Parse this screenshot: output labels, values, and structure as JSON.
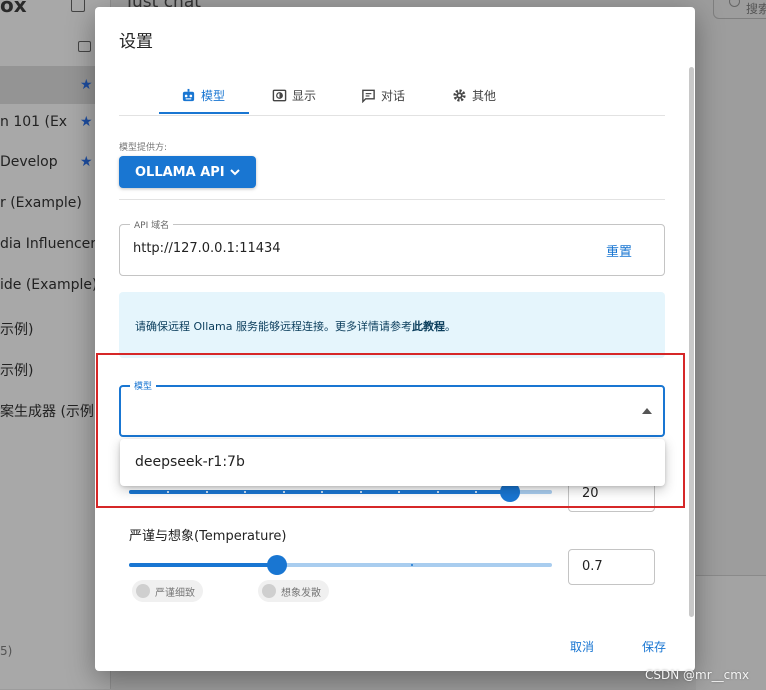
{
  "background": {
    "brand": "ox",
    "chat_title": "Just chat",
    "search_placeholder": "搜索",
    "sidebar_items": [
      {
        "label": "n 101 (Ex",
        "starred": true
      },
      {
        "label": "Develop",
        "starred": true
      },
      {
        "label": "r (Example)",
        "starred": false
      },
      {
        "label": "dia Influencer",
        "starred": false
      },
      {
        "label": "ide (Example)",
        "starred": false
      },
      {
        "label": "示例)",
        "starred": false
      },
      {
        "label": "示例)",
        "starred": false
      },
      {
        "label": "案生成器 (示例)",
        "starred": false
      }
    ],
    "corner_text": "5)"
  },
  "dialog": {
    "title": "设置",
    "tabs": [
      {
        "label": "模型",
        "icon": "robot-icon",
        "active": true
      },
      {
        "label": "显示",
        "icon": "display-icon",
        "active": false
      },
      {
        "label": "对话",
        "icon": "chat-icon",
        "active": false
      },
      {
        "label": "其他",
        "icon": "gear-icon",
        "active": false
      }
    ],
    "provider": {
      "label": "模型提供方:",
      "value": "OLLAMA API"
    },
    "api_host": {
      "label": "API 域名",
      "value": "http://127.0.0.1:11434",
      "reset_label": "重置"
    },
    "info": {
      "text": "请确保远程 Ollama 服务能够远程连接。更多详情请参考",
      "link": "此教程",
      "suffix": "。"
    },
    "model": {
      "label": "模型",
      "value": "",
      "options": [
        "deepseek-r1:7b"
      ]
    },
    "context_slider": {
      "value": "20",
      "fraction": 0.9
    },
    "temperature": {
      "label": "严谨与想象(Temperature)",
      "value": "0.7",
      "fraction": 0.35,
      "chips": [
        "严谨细致",
        "想象发散"
      ]
    },
    "footer": {
      "cancel": "取消",
      "save": "保存"
    }
  },
  "colors": {
    "accent": "#1976d2",
    "highlight": "#d62728",
    "info_bg": "#e5f5fc"
  },
  "watermark": "CSDN @mr__cmx"
}
